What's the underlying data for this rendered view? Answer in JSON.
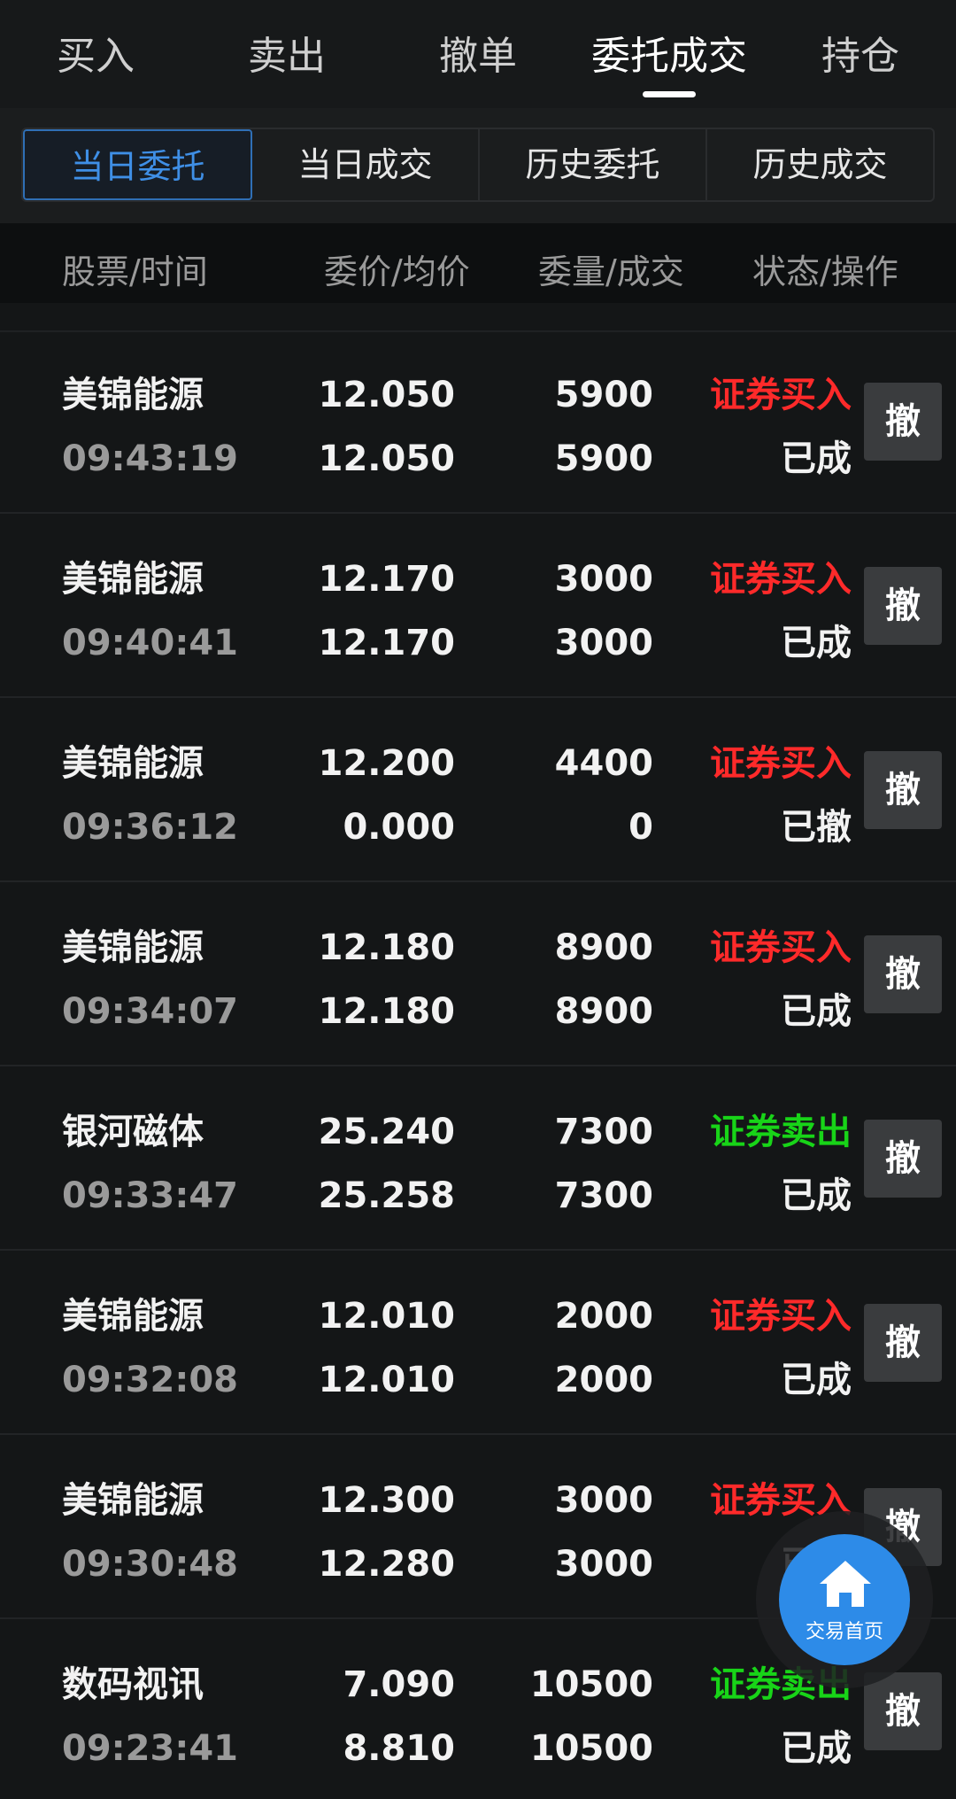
{
  "top_tabs": [
    {
      "label": "买入"
    },
    {
      "label": "卖出"
    },
    {
      "label": "撤单"
    },
    {
      "label": "委托成交",
      "active": true
    },
    {
      "label": "持仓"
    }
  ],
  "sub_tabs": [
    {
      "label": "当日委托",
      "active": true
    },
    {
      "label": "当日成交"
    },
    {
      "label": "历史委托"
    },
    {
      "label": "历史成交"
    }
  ],
  "columns": {
    "stock_time": "股票/时间",
    "price_avg": "委价/均价",
    "qty_filled": "委量/成交",
    "status_action": "状态/操作"
  },
  "orders": [
    {
      "name": "美锦能源",
      "time": "09:43:19",
      "price": "12.050",
      "avg": "12.050",
      "qty": "5900",
      "filled": "5900",
      "type": "证券买入",
      "side": "buy",
      "status": "已成",
      "cancel": "撤"
    },
    {
      "name": "美锦能源",
      "time": "09:40:41",
      "price": "12.170",
      "avg": "12.170",
      "qty": "3000",
      "filled": "3000",
      "type": "证券买入",
      "side": "buy",
      "status": "已成",
      "cancel": "撤"
    },
    {
      "name": "美锦能源",
      "time": "09:36:12",
      "price": "12.200",
      "avg": "0.000",
      "qty": "4400",
      "filled": "0",
      "type": "证券买入",
      "side": "buy",
      "status": "已撤",
      "cancel": "撤"
    },
    {
      "name": "美锦能源",
      "time": "09:34:07",
      "price": "12.180",
      "avg": "12.180",
      "qty": "8900",
      "filled": "8900",
      "type": "证券买入",
      "side": "buy",
      "status": "已成",
      "cancel": "撤"
    },
    {
      "name": "银河磁体",
      "time": "09:33:47",
      "price": "25.240",
      "avg": "25.258",
      "qty": "7300",
      "filled": "7300",
      "type": "证券卖出",
      "side": "sell",
      "status": "已成",
      "cancel": "撤"
    },
    {
      "name": "美锦能源",
      "time": "09:32:08",
      "price": "12.010",
      "avg": "12.010",
      "qty": "2000",
      "filled": "2000",
      "type": "证券买入",
      "side": "buy",
      "status": "已成",
      "cancel": "撤"
    },
    {
      "name": "美锦能源",
      "time": "09:30:48",
      "price": "12.300",
      "avg": "12.280",
      "qty": "3000",
      "filled": "3000",
      "type": "证券买入",
      "side": "buy",
      "status": "已成",
      "cancel": "撤"
    },
    {
      "name": "数码视讯",
      "time": "09:23:41",
      "price": "7.090",
      "avg": "8.810",
      "qty": "10500",
      "filled": "10500",
      "type": "证券卖出",
      "side": "sell",
      "status": "已成",
      "cancel": "撤"
    }
  ],
  "fab": {
    "label": "交易首页",
    "icon": "home-icon"
  },
  "colors": {
    "buy": "#ff2a2a",
    "sell": "#18d418",
    "accent": "#2d8be8"
  }
}
